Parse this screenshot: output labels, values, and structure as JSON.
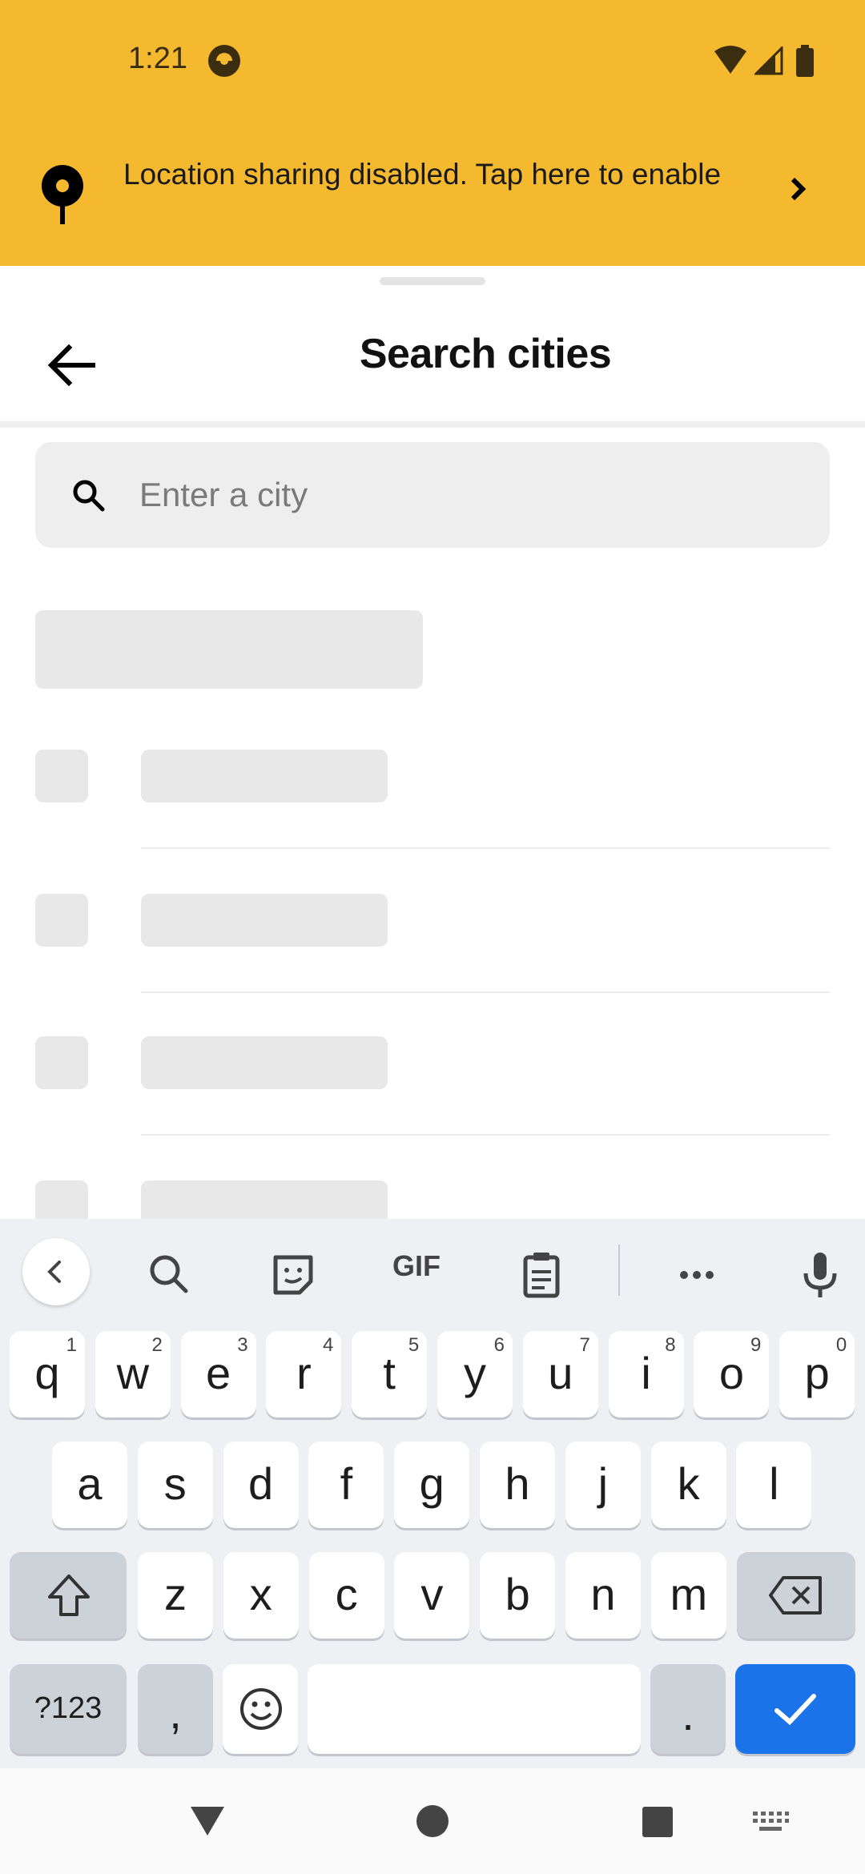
{
  "status_bar": {
    "time": "1:21",
    "app_icon": "circular-app-icon",
    "wifi_icon": "wifi-icon",
    "signal_icon": "signal-icon",
    "battery_icon": "battery-icon"
  },
  "banner": {
    "text": "Location sharing disabled. Tap here to enable",
    "icon": "location-pin-icon",
    "chevron": "chevron-right-icon",
    "color": "#F5B930"
  },
  "sheet": {
    "title": "Search cities",
    "back_icon": "arrow-left-icon",
    "search": {
      "placeholder": "Enter a city",
      "value": "",
      "icon": "search-icon"
    },
    "loading_rows": 4
  },
  "keyboard": {
    "toolbar": [
      "chevron-left-icon",
      "search-icon",
      "sticker-icon",
      "gif-icon",
      "clipboard-icon",
      "more-icon",
      "microphone-icon"
    ],
    "gif_label": "GIF",
    "row1": [
      {
        "k": "q",
        "h": "1"
      },
      {
        "k": "w",
        "h": "2"
      },
      {
        "k": "e",
        "h": "3"
      },
      {
        "k": "r",
        "h": "4"
      },
      {
        "k": "t",
        "h": "5"
      },
      {
        "k": "y",
        "h": "6"
      },
      {
        "k": "u",
        "h": "7"
      },
      {
        "k": "i",
        "h": "8"
      },
      {
        "k": "o",
        "h": "9"
      },
      {
        "k": "p",
        "h": "0"
      }
    ],
    "row2": [
      "a",
      "s",
      "d",
      "f",
      "g",
      "h",
      "j",
      "k",
      "l"
    ],
    "row3": [
      "z",
      "x",
      "c",
      "v",
      "b",
      "n",
      "m"
    ],
    "symbols_label": "?123",
    "comma": ",",
    "period": ".",
    "enter_color": "#1a73e8"
  },
  "nav_bar": [
    "back-triangle-icon",
    "home-circle-icon",
    "recents-square-icon",
    "keyboard-switch-icon"
  ]
}
